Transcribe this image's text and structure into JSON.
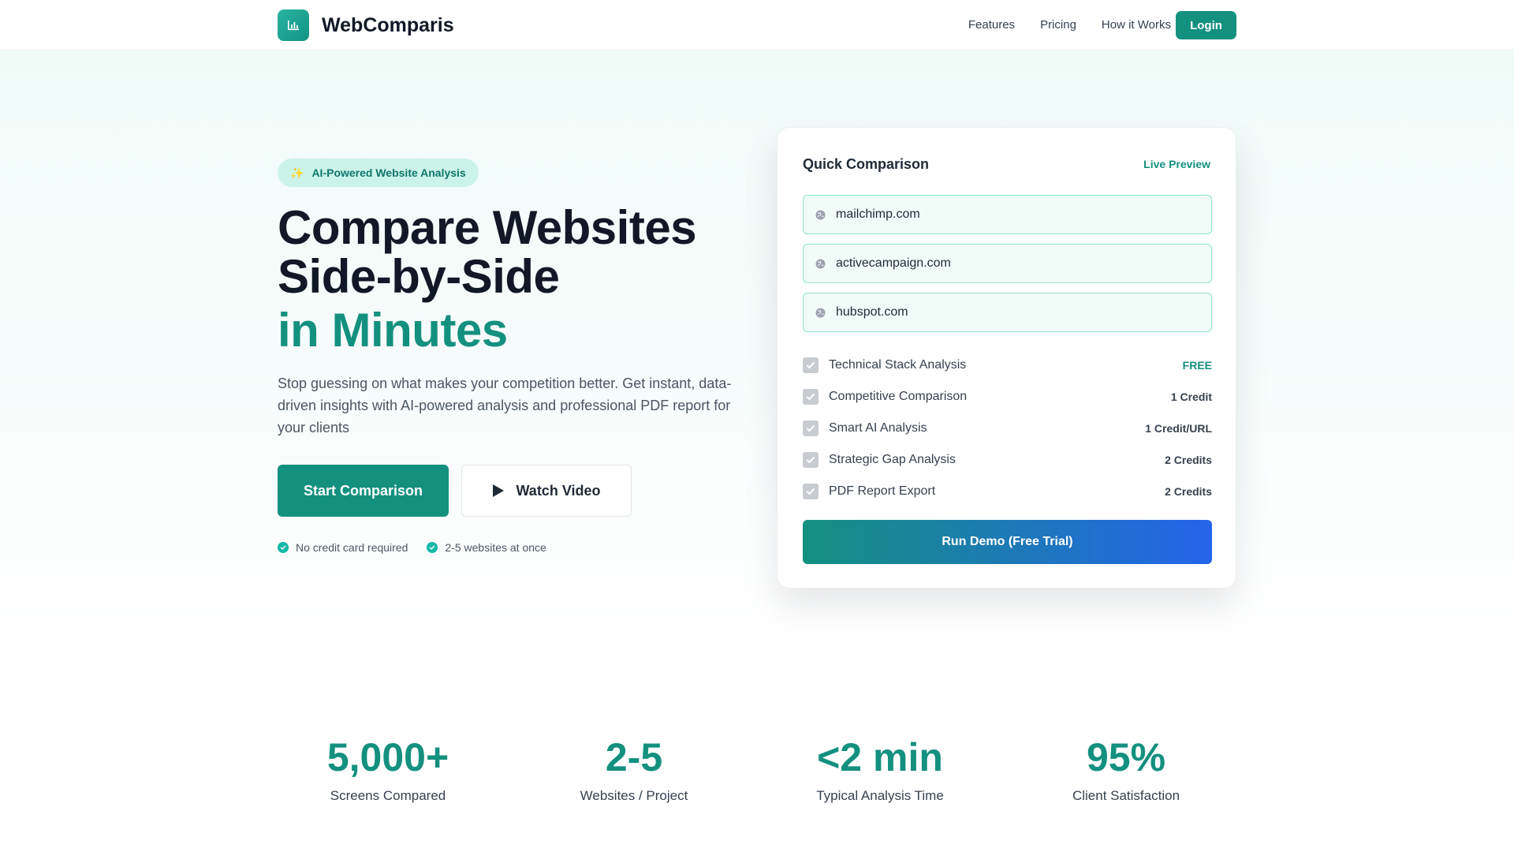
{
  "nav": {
    "brand": "WebComparis",
    "logo_icon": "bar-chart-icon",
    "links": [
      "Features",
      "Pricing",
      "How it Works"
    ],
    "login_label": "Login"
  },
  "hero": {
    "badge": "AI-Powered Website Analysis",
    "badge_icon": "sparkles-icon",
    "title_line1": "Compare Websites",
    "title_line2": "Side-by-Side",
    "title_accent": "in Minutes",
    "subtitle": "Stop guessing on what makes your competition better. Get instant, data-driven insights with AI-powered analysis and professional PDF report for your clients",
    "primary_cta": "Start Comparison",
    "secondary_cta": "Watch Video",
    "secondary_icon": "play-icon",
    "perks": [
      "No credit card required",
      "2-5 websites at once"
    ]
  },
  "card": {
    "title": "Quick Comparison",
    "live_label": "Live Preview",
    "urls": [
      "mailchimp.com",
      "activecampaign.com",
      "hubspot.com"
    ],
    "features": [
      {
        "label": "Technical Stack Analysis",
        "price": "FREE"
      },
      {
        "label": "Competitive Comparison",
        "price": "1 Credit"
      },
      {
        "label": "Smart AI Analysis",
        "price": "1 Credit/URL"
      },
      {
        "label": "Strategic Gap Analysis",
        "price": "2 Credits"
      },
      {
        "label": "PDF Report Export",
        "price": "2 Credits"
      }
    ],
    "run_label": "Run Demo (Free Trial)"
  },
  "stats": [
    {
      "value": "5,000+",
      "label": "Screens Compared"
    },
    {
      "value": "2-5",
      "label": "Websites / Project"
    },
    {
      "value": "<2 min",
      "label": "Typical Analysis Time"
    },
    {
      "value": "95%",
      "label": "Client Satisfaction"
    }
  ],
  "colors": {
    "accent": "#14907f",
    "accent_light": "#ccf3ea",
    "gradient_end": "#2563eb"
  }
}
